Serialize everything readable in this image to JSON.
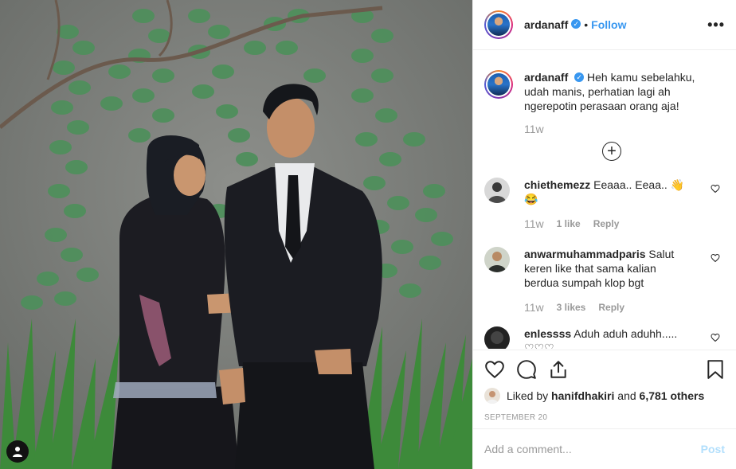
{
  "post": {
    "username": "ardanaff",
    "verified": true,
    "follow_label": "Follow",
    "more_label": "•••",
    "caption": "Heh kamu sebelahku, udah manis, perhatian lagi ah ngerepotin perasaan orang aja!",
    "caption_time": "11w",
    "load_more_icon": "plus-circle-icon"
  },
  "comments": [
    {
      "username": "chiethemezz",
      "text": "Eeaaa.. Eeaa.. 👋😂",
      "time": "11w",
      "likes": "1 like",
      "reply": "Reply"
    },
    {
      "username": "anwarmuhammadparis",
      "text": "Salut keren like that sama kalian berdua sumpah klop bgt",
      "time": "11w",
      "likes": "3 likes",
      "reply": "Reply"
    },
    {
      "username": "enlessss",
      "text": "Aduh aduh aduhh..... ♡♡♡"
    }
  ],
  "likes": {
    "prefix": "Liked by",
    "user": "hanifdhakiri",
    "and": "and",
    "others": "6,781 others"
  },
  "date": "SEPTEMBER 20",
  "add_comment": {
    "placeholder": "Add a comment...",
    "post_label": "Post"
  },
  "colors": {
    "accent": "#3897f0",
    "post_disabled": "#b2dffc",
    "muted": "#999999"
  }
}
